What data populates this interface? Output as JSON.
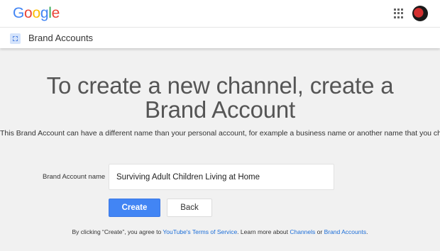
{
  "header": {
    "logo_letters": [
      {
        "char": "G",
        "color": "#4285F4"
      },
      {
        "char": "o",
        "color": "#EA4335"
      },
      {
        "char": "o",
        "color": "#FBBC05"
      },
      {
        "char": "g",
        "color": "#4285F4"
      },
      {
        "char": "l",
        "color": "#34A853"
      },
      {
        "char": "e",
        "color": "#EA4335"
      }
    ],
    "apps_icon": "apps-grid-icon",
    "avatar_icon": "account-avatar"
  },
  "subheader": {
    "icon": "brand-accounts-icon",
    "title": "Brand Accounts"
  },
  "main": {
    "headline": "To create a new channel, create a Brand Account",
    "description": "This Brand Account can have a different name than your personal account, for example a business name or another name that you choose.",
    "field_label": "Brand Account name",
    "field_value": "Surviving Adult Children Living at Home",
    "create_label": "Create",
    "back_label": "Back"
  },
  "terms": {
    "prefix": "By clicking “Create”, you agree to ",
    "tos_link": "YouTube's Terms of Service",
    "middle": ". Learn more about ",
    "channels_link": "Channels",
    "or": " or ",
    "brand_link": "Brand Accounts",
    "suffix": "."
  },
  "colors": {
    "accent": "#4285F4",
    "link": "#1A6DD8",
    "background": "#F1F1F1"
  }
}
